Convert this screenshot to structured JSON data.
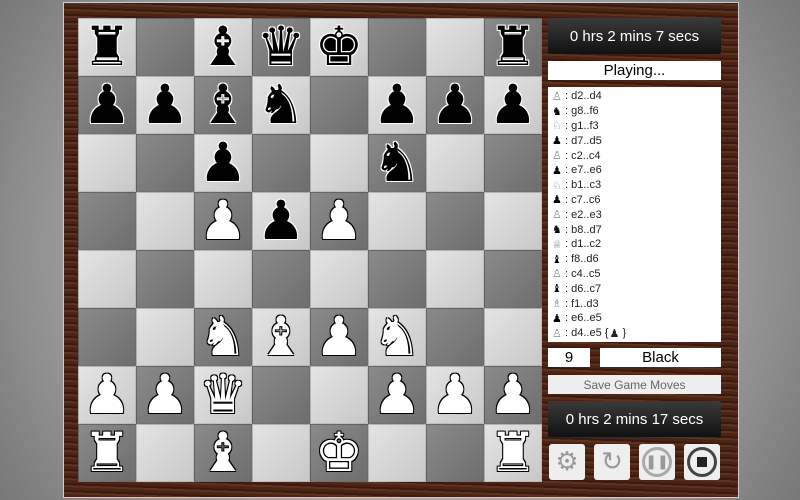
{
  "board": [
    [
      "br",
      "",
      "bb",
      "bq",
      "bk",
      "",
      "",
      "br"
    ],
    [
      "bp",
      "bp",
      "bb",
      "bn",
      "",
      "bp",
      "bp",
      "bp"
    ],
    [
      "",
      "",
      "bp",
      "",
      "",
      "bn",
      "",
      ""
    ],
    [
      "",
      "",
      "wp",
      "bp",
      "wp",
      "",
      "",
      ""
    ],
    [
      "",
      "",
      "",
      "",
      "",
      "",
      "",
      ""
    ],
    [
      "",
      "",
      "wn",
      "wb",
      "wp",
      "wn",
      "",
      ""
    ],
    [
      "wp",
      "wp",
      "wq",
      "",
      "",
      "wp",
      "wp",
      "wp"
    ],
    [
      "wr",
      "",
      "wb",
      "",
      "wk",
      "",
      "",
      "wr"
    ]
  ],
  "panel": {
    "timer_top": "0 hrs 2 mins 7 secs",
    "status": "Playing...",
    "move_number": "9",
    "turn": "Black",
    "save_label": "Save Game Moves",
    "timer_bottom": "0 hrs 2 mins 17 secs"
  },
  "moves": [
    {
      "piece": "wp",
      "text": ": d2..d4"
    },
    {
      "piece": "bn",
      "text": ": g8..f6"
    },
    {
      "piece": "wn",
      "text": ": g1..f3"
    },
    {
      "piece": "bp",
      "text": ": d7..d5"
    },
    {
      "piece": "wp",
      "text": ": c2..c4"
    },
    {
      "piece": "bp",
      "text": ": e7..e6"
    },
    {
      "piece": "wn",
      "text": ": b1..c3"
    },
    {
      "piece": "bp",
      "text": ": c7..c6"
    },
    {
      "piece": "wp",
      "text": ": e2..e3"
    },
    {
      "piece": "bn",
      "text": ": b8..d7"
    },
    {
      "piece": "wq",
      "text": ": d1..c2"
    },
    {
      "piece": "bb",
      "text": ": f8..d6"
    },
    {
      "piece": "wp",
      "text": ": c4..c5"
    },
    {
      "piece": "bb",
      "text": ": d6..c7"
    },
    {
      "piece": "wb",
      "text": ": f1..d3"
    },
    {
      "piece": "bp",
      "text": ": e6..e5"
    },
    {
      "piece": "wp",
      "text": ": d4..e5 {",
      "captured": "bp",
      "suffix": "}"
    }
  ],
  "buttons": [
    "settings-icon",
    "restart-icon",
    "pause-icon",
    "stop-icon"
  ]
}
